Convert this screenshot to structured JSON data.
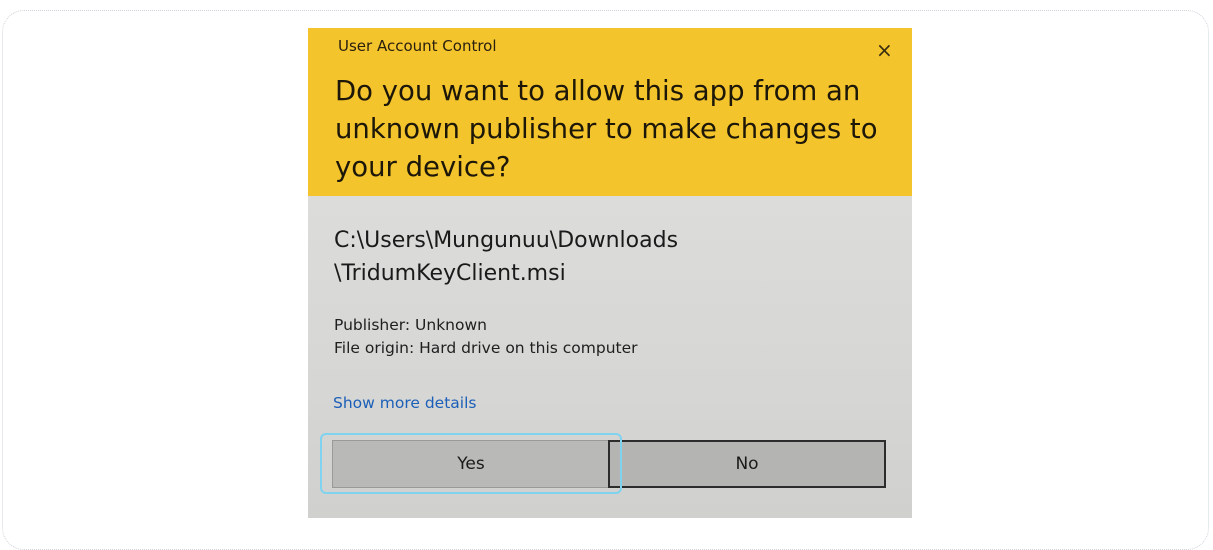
{
  "dialog": {
    "window_title": "User Account Control",
    "close_glyph": "×",
    "question": "Do you want to allow this app from an unknown publisher to make changes to your device?",
    "file_path_line1": "C:\\Users\\Mungunuu\\Downloads",
    "file_path_line2": "\\TridumKeyClient.msi",
    "publisher": "Publisher: Unknown",
    "file_origin": "File origin: Hard drive on this computer",
    "show_more_details": "Show more details",
    "yes_label": "Yes",
    "no_label": "No"
  },
  "colors": {
    "banner": "#f4c42c",
    "body": "#d8d8d6",
    "link": "#1b5fb8",
    "focus_ring": "#7fd3ee"
  },
  "icons": {
    "close": "close-icon"
  }
}
